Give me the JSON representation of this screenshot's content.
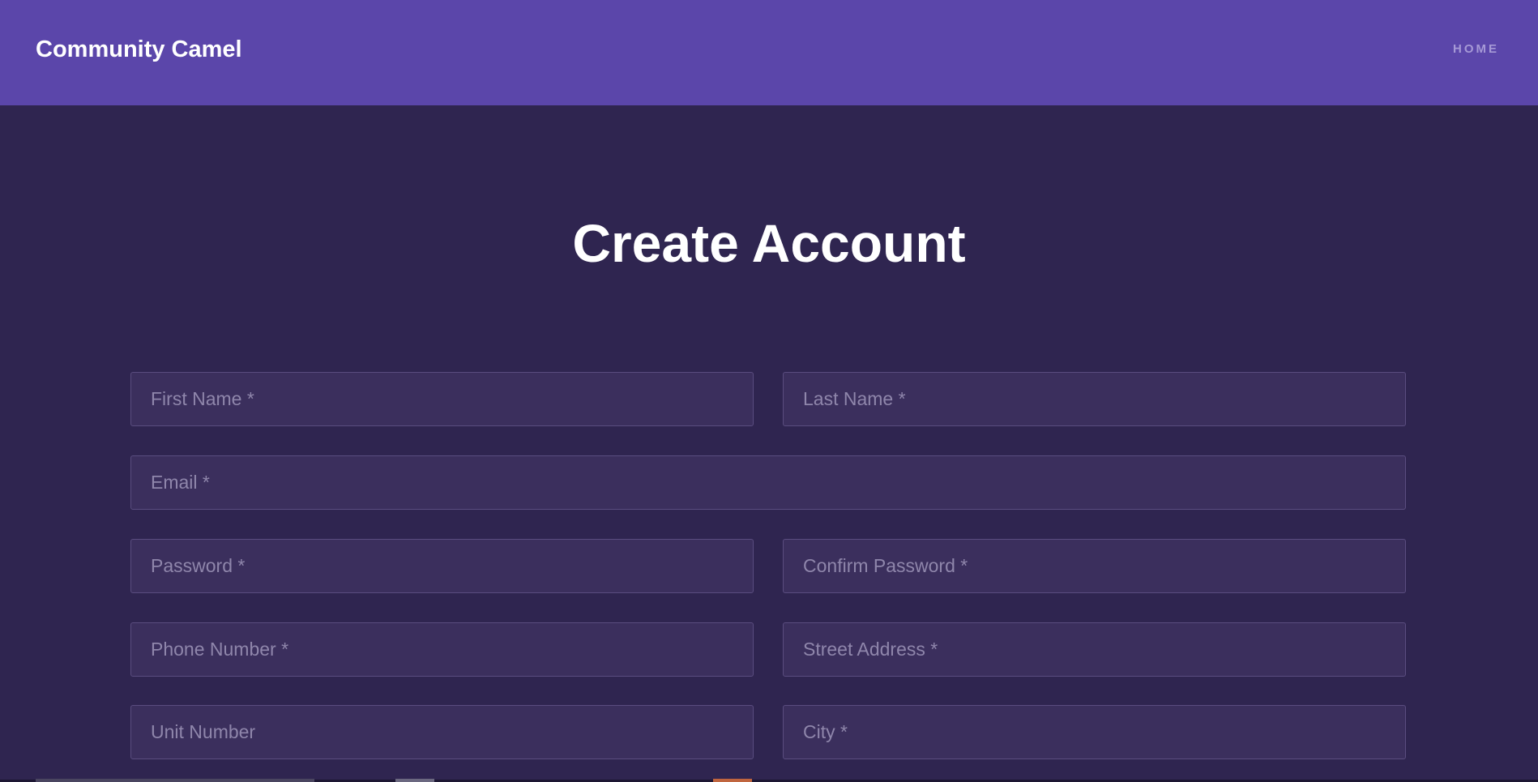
{
  "navbar": {
    "brand": "Community Camel",
    "links": [
      {
        "label": "HOME"
      }
    ]
  },
  "page": {
    "title": "Create Account"
  },
  "form": {
    "fields": {
      "first_name": {
        "placeholder": "First Name *",
        "value": ""
      },
      "last_name": {
        "placeholder": "Last Name *",
        "value": ""
      },
      "email": {
        "placeholder": "Email *",
        "value": ""
      },
      "password": {
        "placeholder": "Password *",
        "value": ""
      },
      "confirm_password": {
        "placeholder": "Confirm Password *",
        "value": ""
      },
      "phone_number": {
        "placeholder": "Phone Number *",
        "value": ""
      },
      "street_address": {
        "placeholder": "Street Address *",
        "value": ""
      },
      "unit_number": {
        "placeholder": "Unit Number",
        "value": ""
      },
      "city": {
        "placeholder": "City *",
        "value": ""
      }
    }
  },
  "colors": {
    "navbar_bg": "#5b46aa",
    "page_bg": "#2f2550",
    "field_bg": "#3b2f5d",
    "field_border": "#5a4d7f",
    "placeholder": "#8f86ab",
    "nav_link": "#a699d6"
  }
}
